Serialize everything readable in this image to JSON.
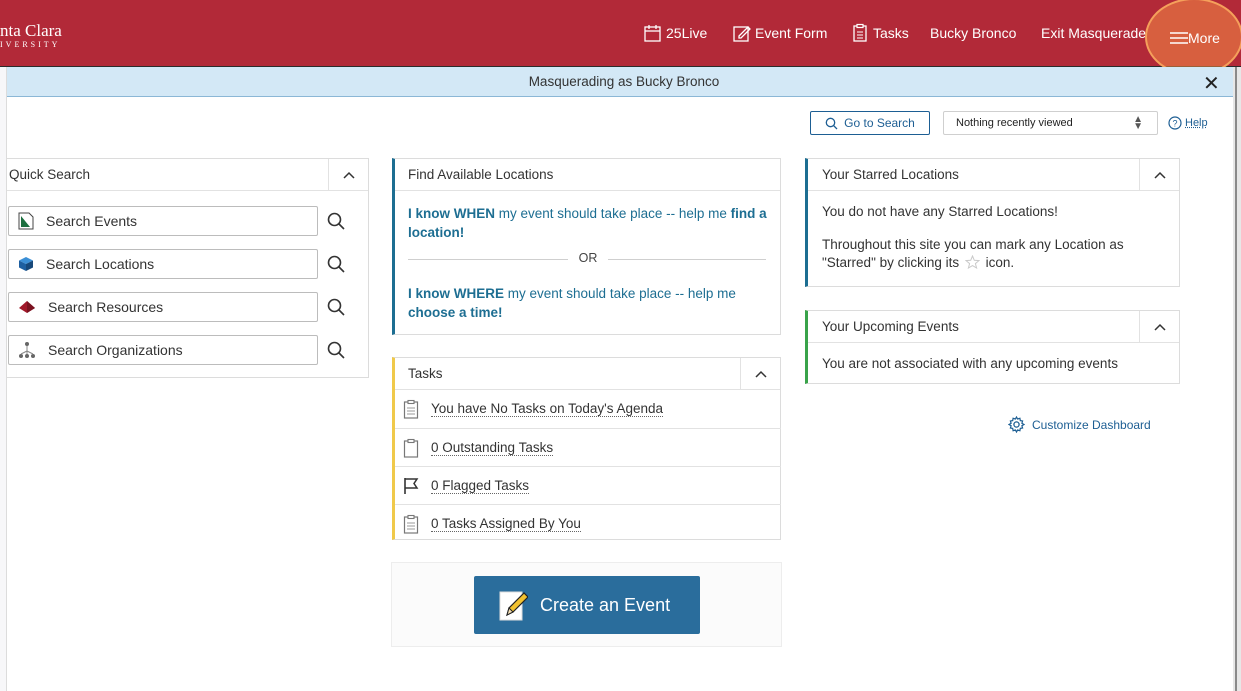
{
  "header": {
    "logo_line1": "nta Clara",
    "logo_line2": "IVERSITY",
    "nav": {
      "live": "25Live",
      "event_form": "Event Form",
      "tasks": "Tasks",
      "user": "Bucky Bronco",
      "exit": "Exit Masquerade",
      "more": "More"
    },
    "brand_color": "#b22938"
  },
  "banner": {
    "text": "Masquerading as Bucky Bronco",
    "close": "✕"
  },
  "toolbar": {
    "go_to_search": "Go to Search",
    "recent_select": "Nothing recently viewed",
    "help": "Help"
  },
  "quick_search": {
    "title": "Quick Search",
    "items": [
      {
        "label": "Search Events",
        "icon": "events-icon"
      },
      {
        "label": "Search Locations",
        "icon": "locations-cube-icon"
      },
      {
        "label": "Search Resources",
        "icon": "resources-diamond-icon"
      },
      {
        "label": "Search Organizations",
        "icon": "organizations-tree-icon"
      }
    ]
  },
  "find_locations": {
    "title": "Find Available Locations",
    "when_bold": "I know WHEN",
    "when_rest": " my event should take place -- help me ",
    "when_link": "find a location!",
    "or": "OR",
    "where_bold": "I know WHERE",
    "where_rest": " my event should take place -- help me ",
    "where_link": "choose a time!"
  },
  "tasks": {
    "title": "Tasks",
    "items": [
      "You have No Tasks on Today's Agenda",
      "0 Outstanding Tasks",
      "0 Flagged Tasks",
      "0 Tasks Assigned By You"
    ]
  },
  "create_event": {
    "label": "Create an Event"
  },
  "starred": {
    "title": "Your Starred Locations",
    "line1": "You do not have any Starred Locations!",
    "line2a": "Throughout this site you can mark any Location as",
    "line2b": "\"Starred\" by clicking its",
    "line2c": "icon."
  },
  "upcoming": {
    "title": "Your Upcoming Events",
    "text": "You are not associated with any upcoming events"
  },
  "customize": {
    "label": "Customize Dashboard"
  }
}
